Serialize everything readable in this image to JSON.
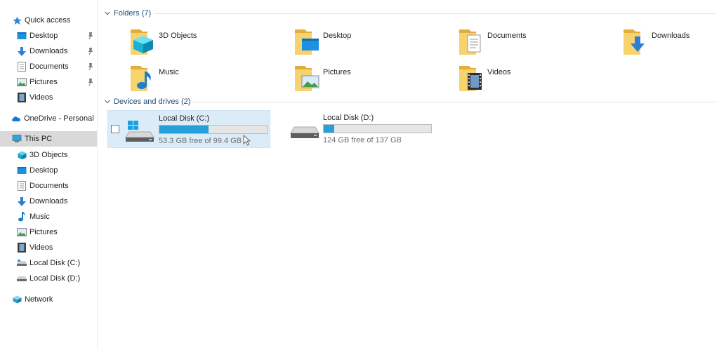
{
  "sidebar": {
    "quick_access": {
      "label": "Quick access",
      "icon": "star-icon"
    },
    "quick_items": [
      {
        "label": "Desktop",
        "icon": "desktop-folder-icon",
        "pinned": true
      },
      {
        "label": "Downloads",
        "icon": "downloads-arrow-icon",
        "pinned": true
      },
      {
        "label": "Documents",
        "icon": "documents-icon",
        "pinned": true
      },
      {
        "label": "Pictures",
        "icon": "pictures-icon",
        "pinned": true
      },
      {
        "label": "Videos",
        "icon": "videos-icon",
        "pinned": false
      }
    ],
    "onedrive": {
      "label": "OneDrive - Personal",
      "icon": "cloud-icon"
    },
    "this_pc": {
      "label": "This PC",
      "icon": "computer-icon",
      "selected": true
    },
    "pc_items": [
      {
        "label": "3D Objects",
        "icon": "3d-objects-icon"
      },
      {
        "label": "Desktop",
        "icon": "desktop-folder-icon"
      },
      {
        "label": "Documents",
        "icon": "documents-icon"
      },
      {
        "label": "Downloads",
        "icon": "downloads-arrow-icon"
      },
      {
        "label": "Music",
        "icon": "music-note-icon"
      },
      {
        "label": "Pictures",
        "icon": "pictures-icon"
      },
      {
        "label": "Videos",
        "icon": "videos-icon"
      },
      {
        "label": "Local Disk (C:)",
        "icon": "drive-icon"
      },
      {
        "label": "Local Disk (D:)",
        "icon": "drive-icon"
      }
    ],
    "network": {
      "label": "Network",
      "icon": "network-icon"
    }
  },
  "main": {
    "folders_group": {
      "label": "Folders (7)"
    },
    "folders": [
      {
        "label": "3D Objects",
        "icon": "3d-objects-folder-icon"
      },
      {
        "label": "Desktop",
        "icon": "desktop-folder-icon"
      },
      {
        "label": "Documents",
        "icon": "documents-folder-icon"
      },
      {
        "label": "Downloads",
        "icon": "downloads-folder-icon"
      },
      {
        "label": "Music",
        "icon": "music-folder-icon"
      },
      {
        "label": "Pictures",
        "icon": "pictures-folder-icon"
      },
      {
        "label": "Videos",
        "icon": "videos-folder-icon"
      }
    ],
    "drives_group": {
      "label": "Devices and drives (2)"
    },
    "drives": [
      {
        "label": "Local Disk (C:)",
        "free_text": "53.3 GB free of 99.4 GB",
        "used_fraction": 0.46,
        "selected": true,
        "system_drive": true
      },
      {
        "label": "Local Disk (D:)",
        "free_text": "124 GB free of 137 GB",
        "used_fraction": 0.1,
        "selected": false,
        "system_drive": false
      }
    ]
  },
  "colors": {
    "accent": "#26a0da",
    "folder": "#f2c55c",
    "selection": "#dbecf8",
    "group_header": "#1f4b7a"
  }
}
